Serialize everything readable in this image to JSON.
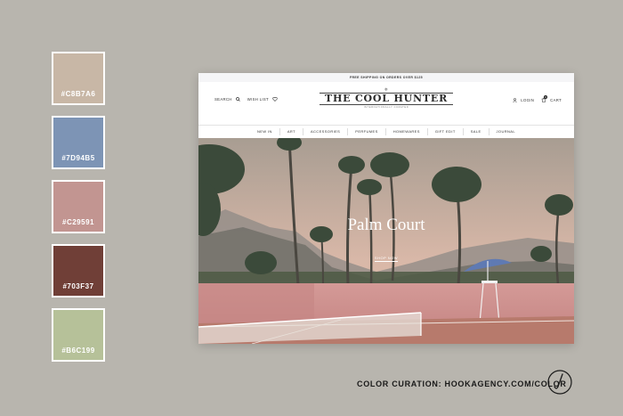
{
  "palette": [
    {
      "hex": "#C8B7A6",
      "label": "#C8B7A6"
    },
    {
      "hex": "#7D94B5",
      "label": "#7D94B5"
    },
    {
      "hex": "#C29591",
      "label": "#C29591"
    },
    {
      "hex": "#703F37",
      "label": "#703F37"
    },
    {
      "hex": "#B6C199",
      "label": "#B6C199"
    }
  ],
  "site": {
    "promo": "FREE SHIPPING ON ORDERS OVER $125",
    "search": "SEARCH",
    "wishlist": "WISH LIST",
    "login": "LOGIN",
    "cart": "CART",
    "cart_count": "0",
    "logo": "THE COOL HUNTER",
    "logo_sub": "INTERNATIONALLY CURATED",
    "nav": [
      "NEW IN",
      "ART",
      "ACCESSORIES",
      "PERFUMES",
      "HOMEWARES",
      "GIFT EDIT",
      "SALE",
      "JOURNAL"
    ],
    "hero_title": "Palm Court",
    "hero_cta": "SHOP NOW"
  },
  "credit": "COLOR CURATION: HOOKAGENCY.COM/COLOR"
}
